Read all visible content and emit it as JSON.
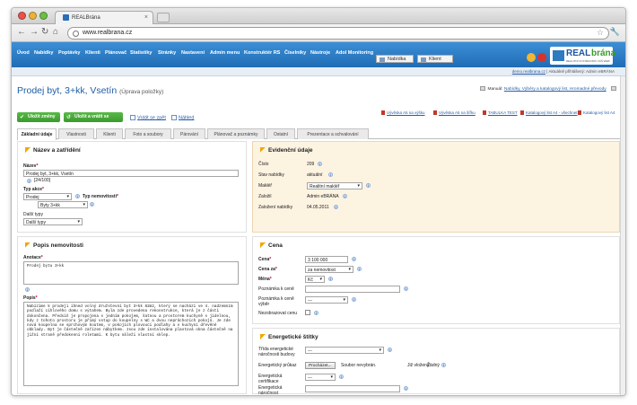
{
  "browser": {
    "tab_title": "REALBrána",
    "url": "www.realbrana.cz"
  },
  "appnav": {
    "items": [
      "Úvod",
      "Nabídky",
      "Poptávky",
      "Klienti",
      "Plánovač",
      "Statistiky",
      "Stránky",
      "Nastavení",
      "Admin menu",
      "Konstruktér RS",
      "Číselníky",
      "Nástroje",
      "Adol Monitoring"
    ],
    "mode_offer": "Nabídka",
    "mode_client": "Klient",
    "logo_real": "REAL",
    "logo_brana": "brána",
    "logo_sub": "REALITNÍ SYSTÉM PRO VÁŠ WEB"
  },
  "subbar": {
    "site": "demo.realbrana.cz",
    "text": "| Aktuálně přihlášený: Admin eBRÁNA"
  },
  "page": {
    "title": "Prodej byt, 3+kk, Vsetín",
    "subtitle": "(Úprava položky)",
    "manual_label": "Manuál:",
    "manual_links": "Nabídky, Výběry a katalogový list, Hromadné převody",
    "save_btn": "Uložit změny",
    "save_back_btn": "Uložit a vrátit se",
    "back_link": "Vrátit se zpět",
    "preview_link": "Náhled",
    "exports": [
      "Vývěska A5 na výšku",
      "Vývěska A5 na šířku",
      "TABULKA TEST",
      "Katalogový list A4 - všechnet",
      "Katalogový list A4"
    ]
  },
  "tabs": [
    "Základní údaje",
    "Vlastnosti",
    "Klienti",
    "Foto a soubory",
    "Párování",
    "Plánovač a poznámky",
    "Ostatní",
    "Prezentace a schvalování"
  ],
  "nazev": {
    "heading": "Název a zatřídění",
    "name_label": "Název",
    "name_value": "Prodej byt, 3+kk, Vsetín",
    "name_counter": "[24/100]",
    "type_label": "Typ akce",
    "type_value": "Prodej",
    "prop_label": "Typ nemovitosti",
    "prop_value": "Byty 3+kk",
    "other_label": "Další typy",
    "other_value": "Další typy"
  },
  "evidence": {
    "heading": "Evidenční údaje",
    "rows": [
      {
        "label": "Číslo",
        "value": "209"
      },
      {
        "label": "Stav nabídky",
        "value": "aktuální"
      },
      {
        "label": "Makléř",
        "value": "Realitní makléř"
      },
      {
        "label": "Založil",
        "value": "Admin eBRÁNA"
      },
      {
        "label": "Založení nabídky",
        "value": "04.05.2011"
      }
    ]
  },
  "popis": {
    "heading": "Popis nemovitosti",
    "annotation_label": "Anotace",
    "annotation_value": "Prodej bytu 3+kk",
    "desc_label": "Popis",
    "desc_value": "Nabízíme k prodeji ihned volný družstevní byt 3+kk 82m2, který se nachází ve 4. nadzemním podlaží cihlového domu s výtahem. Byla zde provedena rekonstrukce, která je z části dokončena. Předsíň je propojena s jedním pokojem, šatnou a prostorem kuchyně s jídelnou, kdy z tohoto prostoru je přímý vstup do koupelny s WC a dvou neprůchozích pokojů. Je zde nová koupelna se sprchovým koutem, v pokojích plovoucí podlahy a v kuchyni dřevěné obklady. Byt je částečně zařízen nábytkem. Jsou zde instalována plastová okna částečně na jižní straně předokenní roletami. K bytu náleží vlastní sklep."
  },
  "cena": {
    "heading": "Cena",
    "price_label": "Cena",
    "price_value": "3 100 000",
    "per_label": "Cena za",
    "per_value": "za nemovitost",
    "currency_label": "Měna",
    "currency_value": "Kč",
    "note_label": "Poznámka k ceně",
    "note_value": "",
    "note_sel_label": "Poznámka k ceně výběr",
    "note_sel_value": "---",
    "hide_label": "Nezobrazovat cenu"
  },
  "energy": {
    "heading": "Energetické štítky",
    "class_label": "Třída energetické náročnosti budovy",
    "class_value": "---",
    "pruk_label": "Energetický průkaz",
    "browse_btn": "Procházet...",
    "no_file": "Soubor nevybrán.",
    "uploaded_label": "Již vložený:",
    "uploaded_value": "Žádný",
    "cert_label": "Energetická certifikace",
    "cert_value": "---",
    "nar_label": "Energetická náročnost",
    "nar_value": ""
  }
}
